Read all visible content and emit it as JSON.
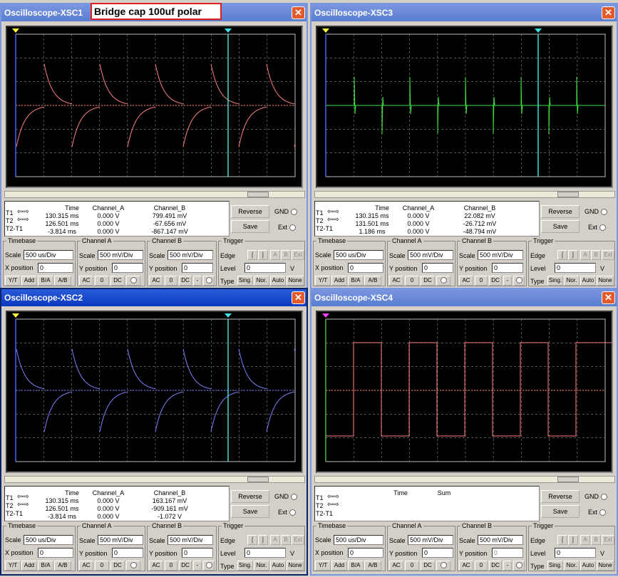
{
  "annotation": "Bridge cap 100uf polar",
  "labels": {
    "t1": "T1",
    "t2": "T2",
    "t21": "T2-T1",
    "time": "Time",
    "cha": "Channel_A",
    "chb": "Channel_B",
    "sum": "Sum",
    "reverse": "Reverse",
    "save": "Save",
    "gnd": "GND",
    "ext": "Ext",
    "timebase": "Timebase",
    "scale": "Scale",
    "xpos": "X position",
    "ypos": "Y position",
    "trigger": "Trigger",
    "edge": "Edge",
    "level": "Level",
    "type": "Type",
    "yt": "Y/T",
    "add": "Add",
    "ba": "B/A",
    "ab": "A/B",
    "ac": "AC",
    "zero": "0",
    "dc": "DC",
    "minus": "-",
    "sing": "Sing.",
    "nor": "Nor.",
    "auto": "Auto",
    "none": "None",
    "a": "A",
    "b": "B",
    "extbtn": "Ext",
    "v": "V",
    "channel_a": "Channel A",
    "channel_b": "Channel B"
  },
  "windows": [
    {
      "title": "Oscilloscope-XSC1",
      "trace_color": "#ff8080",
      "waveform": "cap-rising",
      "t1_time": "130.315 ms",
      "t2_time": "126.501 ms",
      "dt_time": "-3.814 ms",
      "t1_a": "0.000 V",
      "t2_a": "0.000 V",
      "dt_a": "0.000 V",
      "t1_b": "799.491 mV",
      "t2_b": "-67.656 mV",
      "dt_b": "-867.147 mV",
      "timebase_scale": "500 us/Div",
      "x_position": "0",
      "cha_scale": "500 mV/Div",
      "cha_ypos": "0",
      "chb_scale": "500 mV/Div",
      "chb_ypos": "0",
      "trig_level": "0"
    },
    {
      "title": "Oscilloscope-XSC3",
      "trace_color": "#40e040",
      "waveform": "spikes",
      "t1_time": "130.315 ms",
      "t2_time": "131.501 ms",
      "dt_time": "1.186 ms",
      "t1_a": "0.000 V",
      "t2_a": "0.000 V",
      "dt_a": "0.000 V",
      "t1_b": "22.082 mV",
      "t2_b": "-26.712 mV",
      "dt_b": "-48.794 mV",
      "timebase_scale": "500 us/Div",
      "x_position": "0",
      "cha_scale": "500 mV/Div",
      "cha_ypos": "0",
      "chb_scale": "500 mV/Div",
      "chb_ypos": "0",
      "trig_level": "0"
    },
    {
      "title": "Oscilloscope-XSC2",
      "trace_color": "#8080ff",
      "waveform": "cap-falling",
      "t1_time": "130.315 ms",
      "t2_time": "126.501 ms",
      "dt_time": "-3.814 ms",
      "t1_a": "0.000 V",
      "t2_a": "0.000 V",
      "dt_a": "0.000 V",
      "t1_b": "163.167 mV",
      "t2_b": "-909.161 mV",
      "dt_b": "-1.072 V",
      "timebase_scale": "500 us/Div",
      "x_position": "0",
      "cha_scale": "500 mV/Div",
      "cha_ypos": "0",
      "chb_scale": "500 mV/Div",
      "chb_ypos": "0",
      "trig_level": "0"
    },
    {
      "title": "Oscilloscope-XSC4",
      "trace_color": "#ff8080",
      "waveform": "square",
      "t1_time": "",
      "t2_time": "",
      "dt_time": "",
      "t1_a": "",
      "t2_a": "",
      "dt_a": "",
      "t1_b": "",
      "t2_b": "",
      "dt_b": "",
      "timebase_scale": "500 us/Div",
      "x_position": "0",
      "cha_scale": "500 mV/Div",
      "cha_ypos": "0",
      "chb_scale": "500 mV/Div",
      "chb_ypos": "0",
      "trig_level": "0"
    }
  ],
  "colors": {
    "grid": "#c0c0c0",
    "cursor1": "#4060ff",
    "cursor2": "#40e0e0",
    "trace_axis": "#ff6060"
  },
  "icons": {
    "close": "close-icon",
    "cursor_arrows": "arrow-left-right-icon",
    "rising_edge": "rising-edge-icon",
    "falling_edge": "falling-edge-icon"
  }
}
